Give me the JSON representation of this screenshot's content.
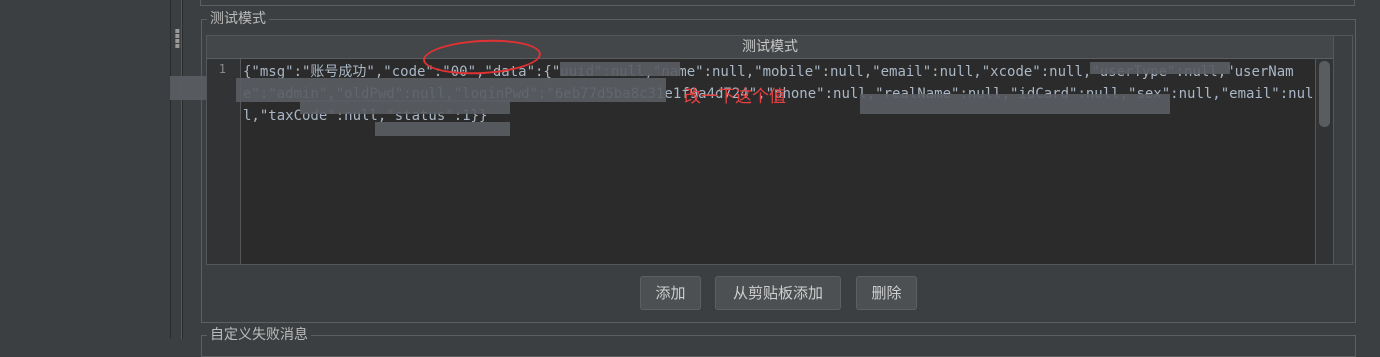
{
  "test_mode_group": {
    "legend": "测试模式",
    "table_header": "测试模式",
    "line_numbers": [
      "1"
    ],
    "content_text": "{\"msg\":\"账号成功\",\"code\":\"00\",\"data\":{\"uuid\":null,\"name\":null,\"mobile\":null,\"email\":null,\"xcode\":null,\"userType\":null,\"userName\":\"admin\",\"oldPwd\":null,\"loginPwd\":\"6eb77d5ba8c31e1f9a4d724\",\"phone\":null,\"realName\":null,\"idCard\":null,\"sex\":null,\"email\":null,\"taxCode\":null,\"status\":1}}"
  },
  "annotation": {
    "text": "改一下这个值",
    "color": "#e84040"
  },
  "buttons": {
    "add": "添加",
    "add_from_clipboard": "从剪贴板添加",
    "delete": "删除"
  },
  "custom_fail_group": {
    "legend": "自定义失败消息"
  },
  "colors": {
    "background": "#3c3f41",
    "editor_background": "#2b2b2b",
    "annotation_red": "#e03232"
  }
}
